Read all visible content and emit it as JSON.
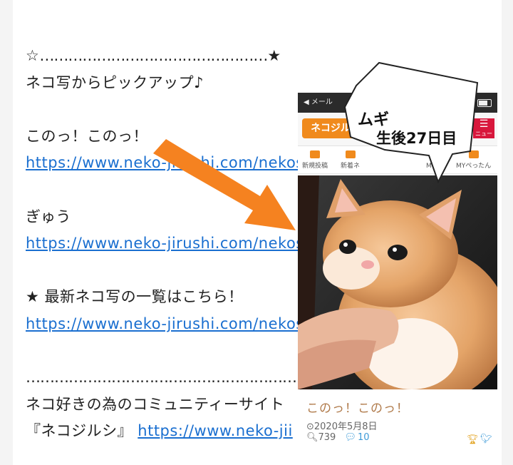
{
  "post": {
    "deco_star_open": "☆",
    "deco_dots": "…………………………………………",
    "deco_star_close": "★",
    "intro": "ネコ写からピックアップ♪",
    "item1_title": "このっ！このっ！",
    "item1_link": "https://www.neko-jirushi.com/nekos",
    "item2_title": "ぎゅう",
    "item2_link": "https://www.neko-jirushi.com/nekos",
    "latest_label": "★ 最新ネコ写の一覧はこちら！",
    "latest_link": "https://www.neko-jirushi.com/nekos",
    "footer_dots": "……………………………………………………………",
    "footer_text": "ネコ好きの為のコミュニティーサイト",
    "footer_site": "『ネコジルシ』",
    "footer_link": "https://www.neko-jii"
  },
  "phone": {
    "status_text": "◀ メール",
    "logo_text": "ネコジル",
    "menu_label": "ニュー",
    "nav_items": [
      "新規投稿",
      "新着ネ",
      "MYペ",
      "MYペったん"
    ]
  },
  "bubble": {
    "name": "ムギ",
    "age": "生後27日目"
  },
  "card": {
    "title": "このっ！このっ！",
    "date": "⊙2020年5月8日",
    "views": "739",
    "comments": "10"
  },
  "colors": {
    "link": "#1a6fd0",
    "arrow": "#f58220",
    "menu": "#d8173c",
    "card_title": "#b07a4a",
    "accent_blue": "#3d9ad8"
  }
}
